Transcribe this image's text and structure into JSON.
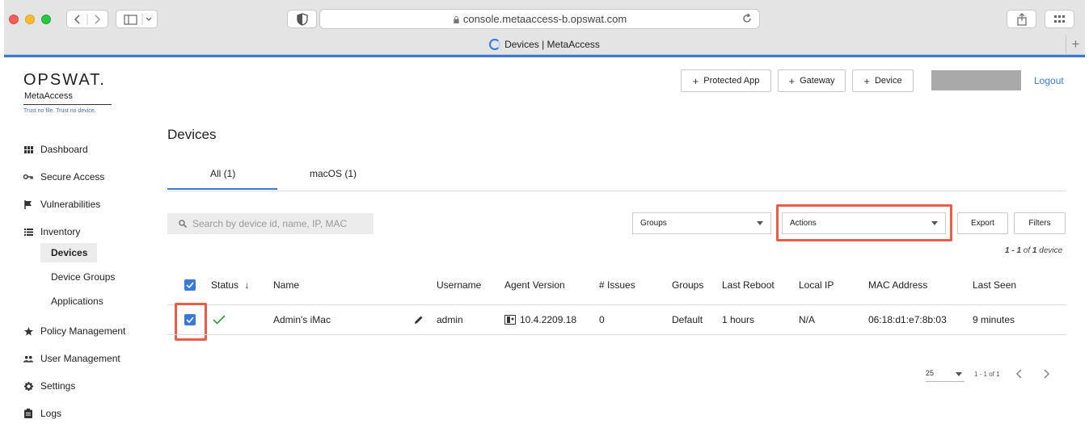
{
  "browser": {
    "url": "console.metaaccess-b.opswat.com",
    "tab_title": "Devices | MetaAccess"
  },
  "brand": {
    "logo": "OPSWAT.",
    "product": "MetaAccess",
    "tagline": "Trust no file. Trust no device."
  },
  "sidebar": {
    "items": [
      {
        "label": "Dashboard",
        "icon": "grid-icon"
      },
      {
        "label": "Secure Access",
        "icon": "key-icon"
      },
      {
        "label": "Vulnerabilities",
        "icon": "flag-icon"
      },
      {
        "label": "Inventory",
        "icon": "list-icon"
      },
      {
        "label": "Policy Management",
        "icon": "star-icon"
      },
      {
        "label": "User Management",
        "icon": "users-icon"
      },
      {
        "label": "Settings",
        "icon": "gear-icon"
      },
      {
        "label": "Logs",
        "icon": "clipboard-icon"
      }
    ],
    "inventory_sub": [
      "Devices",
      "Device Groups",
      "Applications"
    ],
    "active_sub": "Devices"
  },
  "header": {
    "protected_app": "Protected App",
    "gateway": "Gateway",
    "device": "Device",
    "logout": "Logout"
  },
  "page": {
    "title": "Devices",
    "tabs": [
      {
        "label": "All (1)",
        "active": true
      },
      {
        "label": "macOS (1)",
        "active": false
      }
    ],
    "search_placeholder": "Search by device id, name, IP, MAC",
    "groups_select": "Groups",
    "actions_select": "Actions",
    "export": "Export",
    "filters": "Filters",
    "count_range": "1 - 1",
    "count_of": "of",
    "count_total": "1",
    "count_unit": "device"
  },
  "table": {
    "columns": [
      "Status",
      "Name",
      "Username",
      "Agent Version",
      "# Issues",
      "Groups",
      "Last Reboot",
      "Local IP",
      "MAC Address",
      "Last Seen"
    ],
    "sort_indicator": "↓",
    "rows": [
      {
        "status": "ok",
        "name": "Admin's iMac",
        "username": "admin",
        "agent_version": "10.4.2209.18",
        "issues": "0",
        "groups": "Default",
        "last_reboot": "1 hours",
        "local_ip": "N/A",
        "mac": "06:18:d1:e7:8b:03",
        "last_seen": "9 minutes",
        "checked": true
      }
    ]
  },
  "pagination": {
    "page_size": "25",
    "range": "1 - 1 of 1"
  },
  "colors": {
    "accent": "#3a79d6",
    "highlight": "#ea5d49",
    "success": "#2e9d3a"
  }
}
